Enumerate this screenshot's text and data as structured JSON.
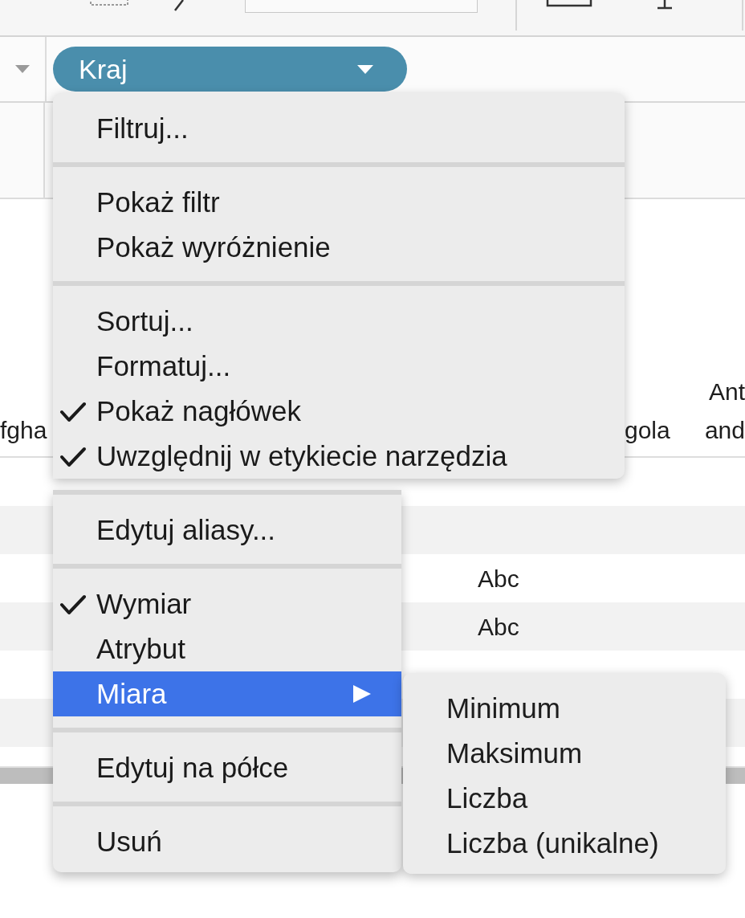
{
  "shelf": {
    "pill": {
      "label": "Kraj"
    }
  },
  "table": {
    "column_headers": [
      {
        "lines": [
          "fgha"
        ]
      },
      {
        "lines": [
          "gola"
        ]
      },
      {
        "lines": [
          "Ant",
          "and"
        ]
      }
    ],
    "rows": [
      {
        "cells": []
      },
      {
        "cells": []
      },
      {
        "cells": [
          "Abc"
        ]
      },
      {
        "cells": [
          "Abc"
        ]
      },
      {
        "cells": []
      },
      {
        "cells": []
      }
    ]
  },
  "menu": {
    "sections": [
      [
        {
          "label": "Filtruj...",
          "checked": false,
          "selected": false,
          "has_submenu": false
        }
      ],
      [
        {
          "label": "Pokaż filtr",
          "checked": false,
          "selected": false,
          "has_submenu": false
        },
        {
          "label": "Pokaż wyróżnienie",
          "checked": false,
          "selected": false,
          "has_submenu": false
        }
      ],
      [
        {
          "label": "Sortuj...",
          "checked": false,
          "selected": false,
          "has_submenu": false
        },
        {
          "label": "Formatuj...",
          "checked": false,
          "selected": false,
          "has_submenu": false
        },
        {
          "label": "Pokaż nagłówek",
          "checked": true,
          "selected": false,
          "has_submenu": false
        },
        {
          "label": "Uwzględnij w etykiecie narzędzia",
          "checked": true,
          "selected": false,
          "has_submenu": false
        }
      ],
      [
        {
          "label": "Edytuj aliasy...",
          "checked": false,
          "selected": false,
          "has_submenu": false
        }
      ],
      [
        {
          "label": "Wymiar",
          "checked": true,
          "selected": false,
          "has_submenu": false
        },
        {
          "label": "Atrybut",
          "checked": false,
          "selected": false,
          "has_submenu": false
        },
        {
          "label": "Miara",
          "checked": false,
          "selected": true,
          "has_submenu": true
        }
      ],
      [
        {
          "label": "Edytuj na półce",
          "checked": false,
          "selected": false,
          "has_submenu": false
        }
      ],
      [
        {
          "label": "Usuń",
          "checked": false,
          "selected": false,
          "has_submenu": false
        }
      ]
    ]
  },
  "submenu": {
    "items": [
      {
        "label": "Minimum"
      },
      {
        "label": "Maksimum"
      },
      {
        "label": "Liczba"
      },
      {
        "label": "Liczba (unikalne)"
      }
    ]
  }
}
